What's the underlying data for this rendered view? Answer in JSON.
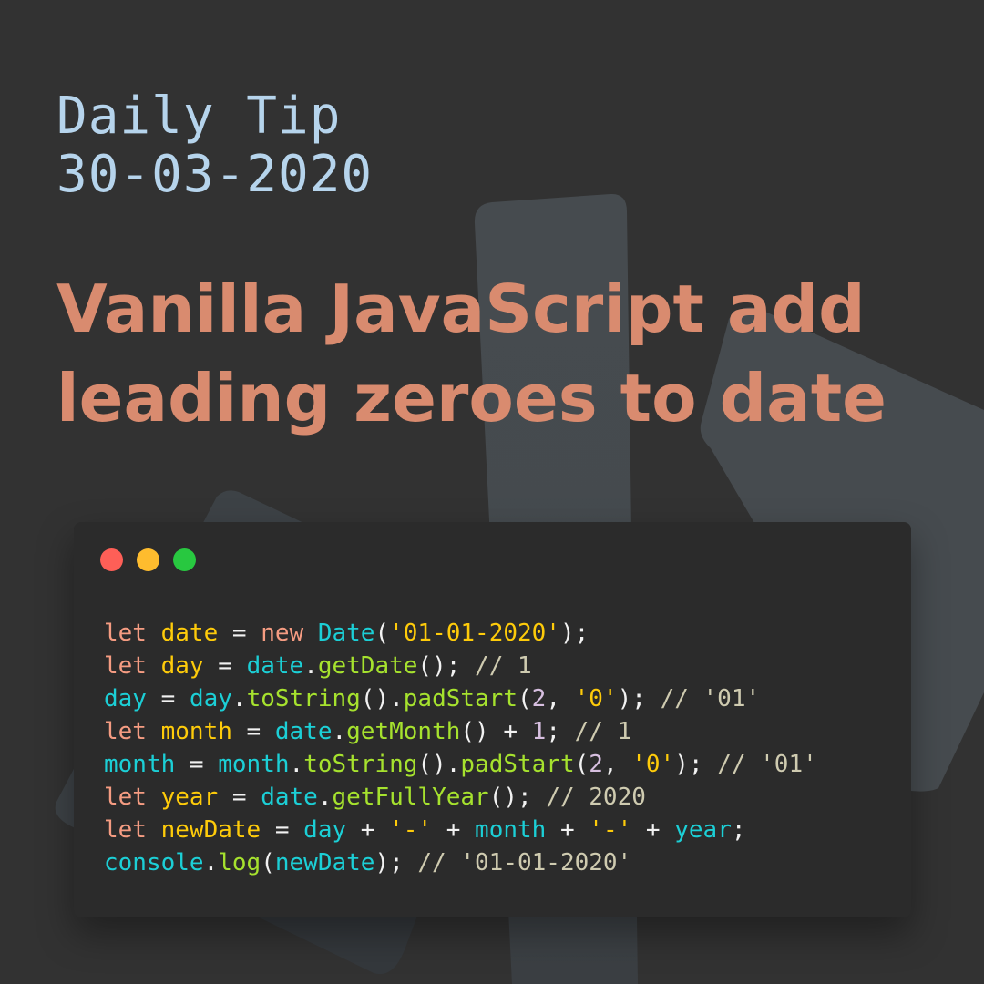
{
  "header": {
    "label_line1": "Daily Tip",
    "label_line2": "30-03-2020"
  },
  "title": {
    "line1": "Vanilla JavaScript add",
    "line2": "leading zeroes to date"
  },
  "colors": {
    "background": "#323232",
    "accent_title": "#d98b6f",
    "accent_header": "#b6d4ec",
    "window_bg": "#2b2b2b",
    "shape": "#464b4f"
  },
  "window": {
    "controls": [
      {
        "name": "close",
        "color": "#fe5f57"
      },
      {
        "name": "minimize",
        "color": "#febc2e"
      },
      {
        "name": "maximize",
        "color": "#28c840"
      }
    ]
  },
  "syntax_colors": {
    "kw": "#f59c82",
    "var": "#fecb0a",
    "ref": "#1ccfd6",
    "fn": "#a6e22e",
    "str": "#fecb0a",
    "num": "#d7bfe0",
    "cmt": "#cfcbb0",
    "pun": "#f2f2f2"
  },
  "code": {
    "language": "javascript",
    "lines": [
      [
        [
          "kw",
          "let "
        ],
        [
          "var",
          "date"
        ],
        [
          "pun",
          " = "
        ],
        [
          "kw",
          "new "
        ],
        [
          "ref",
          "Date"
        ],
        [
          "pun",
          "("
        ],
        [
          "str",
          "'01-01-2020'"
        ],
        [
          "pun",
          ");"
        ]
      ],
      [
        [
          "kw",
          "let "
        ],
        [
          "var",
          "day"
        ],
        [
          "pun",
          " = "
        ],
        [
          "ref",
          "date"
        ],
        [
          "pun",
          "."
        ],
        [
          "fn",
          "getDate"
        ],
        [
          "pun",
          "(); "
        ],
        [
          "cmt",
          "// 1"
        ]
      ],
      [
        [
          "ref",
          "day"
        ],
        [
          "pun",
          " = "
        ],
        [
          "ref",
          "day"
        ],
        [
          "pun",
          "."
        ],
        [
          "fn",
          "toString"
        ],
        [
          "pun",
          "()."
        ],
        [
          "fn",
          "padStart"
        ],
        [
          "pun",
          "("
        ],
        [
          "num",
          "2"
        ],
        [
          "pun",
          ", "
        ],
        [
          "str",
          "'0'"
        ],
        [
          "pun",
          "); "
        ],
        [
          "cmt",
          "// '01'"
        ]
      ],
      [
        [
          "kw",
          "let "
        ],
        [
          "var",
          "month"
        ],
        [
          "pun",
          " = "
        ],
        [
          "ref",
          "date"
        ],
        [
          "pun",
          "."
        ],
        [
          "fn",
          "getMonth"
        ],
        [
          "pun",
          "() + "
        ],
        [
          "num",
          "1"
        ],
        [
          "pun",
          "; "
        ],
        [
          "cmt",
          "// 1"
        ]
      ],
      [
        [
          "ref",
          "month"
        ],
        [
          "pun",
          " = "
        ],
        [
          "ref",
          "month"
        ],
        [
          "pun",
          "."
        ],
        [
          "fn",
          "toString"
        ],
        [
          "pun",
          "()."
        ],
        [
          "fn",
          "padStart"
        ],
        [
          "pun",
          "("
        ],
        [
          "num",
          "2"
        ],
        [
          "pun",
          ", "
        ],
        [
          "str",
          "'0'"
        ],
        [
          "pun",
          "); "
        ],
        [
          "cmt",
          "// '01'"
        ]
      ],
      [
        [
          "kw",
          "let "
        ],
        [
          "var",
          "year"
        ],
        [
          "pun",
          " = "
        ],
        [
          "ref",
          "date"
        ],
        [
          "pun",
          "."
        ],
        [
          "fn",
          "getFullYear"
        ],
        [
          "pun",
          "(); "
        ],
        [
          "cmt",
          "// 2020"
        ]
      ],
      [
        [
          "kw",
          "let "
        ],
        [
          "var",
          "newDate"
        ],
        [
          "pun",
          " = "
        ],
        [
          "ref",
          "day"
        ],
        [
          "pun",
          " + "
        ],
        [
          "str",
          "'-'"
        ],
        [
          "pun",
          " + "
        ],
        [
          "ref",
          "month"
        ],
        [
          "pun",
          " + "
        ],
        [
          "str",
          "'-'"
        ],
        [
          "pun",
          " + "
        ],
        [
          "ref",
          "year"
        ],
        [
          "pun",
          ";"
        ]
      ],
      [
        [
          "ref",
          "console"
        ],
        [
          "pun",
          "."
        ],
        [
          "fn",
          "log"
        ],
        [
          "pun",
          "("
        ],
        [
          "ref",
          "newDate"
        ],
        [
          "pun",
          "); "
        ],
        [
          "cmt",
          "// '01-01-2020'"
        ]
      ]
    ]
  }
}
